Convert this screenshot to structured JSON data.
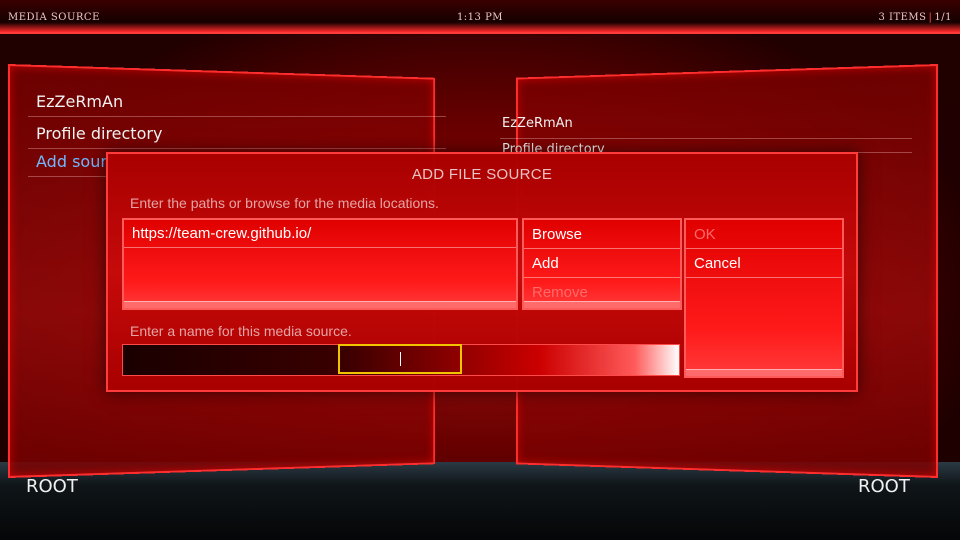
{
  "topbar": {
    "title": "MEDIA SOURCE",
    "time": "1:13 PM",
    "items_count": "3 ITEMS",
    "page": "1/1"
  },
  "left_panel": {
    "items": [
      {
        "label": "EzZeRmAn"
      },
      {
        "label": "Profile directory"
      },
      {
        "label": "Add sour"
      }
    ],
    "root_label": "ROOT"
  },
  "right_panel": {
    "items": [
      {
        "label": "EzZeRmAn"
      },
      {
        "label": "Profile directory"
      }
    ],
    "root_label": "ROOT"
  },
  "dialog": {
    "title": "ADD FILE SOURCE",
    "paths_prompt": "Enter the paths or browse for the media locations.",
    "path_value": "https://team-crew.github.io/",
    "buttons": {
      "browse": "Browse",
      "add": "Add",
      "remove": "Remove",
      "ok": "OK",
      "cancel": "Cancel"
    },
    "name_prompt": "Enter a name for this media source.",
    "name_value": ""
  },
  "colors": {
    "accent": "#ff2e2e",
    "focus": "#f2c400",
    "active_item": "#6fb7ff"
  }
}
